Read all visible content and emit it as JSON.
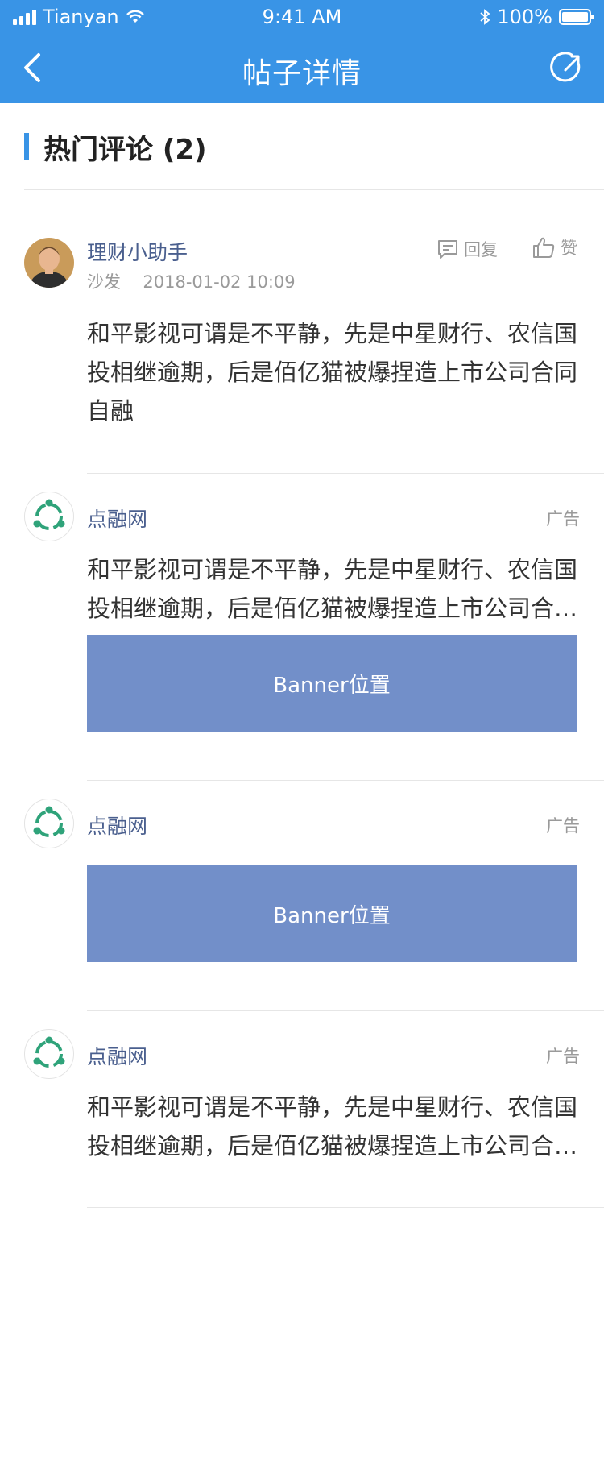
{
  "status_bar": {
    "carrier": "Tianyan",
    "time": "9:41 AM",
    "battery": "100%"
  },
  "nav": {
    "title": "帖子详情"
  },
  "section": {
    "title": "热门评论 (2)"
  },
  "comment": {
    "user": "理财小助手",
    "floor": "沙发",
    "time": "2018-01-02 10:09",
    "reply_label": "回复",
    "like_label": "赞",
    "text": "和平影视可谓是不平静，先是中星财行、农信国投相继逾期，后是佰亿猫被爆捏造上市公司合同自融"
  },
  "ads": [
    {
      "name": "点融网",
      "tag": "广告",
      "text": "和平影视可谓是不平静，先是中星财行、农信国投相继逾期，后是佰亿猫被爆捏造上市公司合同自融",
      "banner": "Banner位置"
    },
    {
      "name": "点融网",
      "tag": "广告",
      "banner": "Banner位置"
    },
    {
      "name": "点融网",
      "tag": "广告",
      "text": "和平影视可谓是不平静，先是中星财行、农信国投相继逾期，后是佰亿猫被爆捏造上市公司合同自融"
    }
  ],
  "colors": {
    "primary": "#3994e6",
    "banner": "#728fc9",
    "link": "#4a5f8e",
    "logo": "#2fa37a"
  }
}
